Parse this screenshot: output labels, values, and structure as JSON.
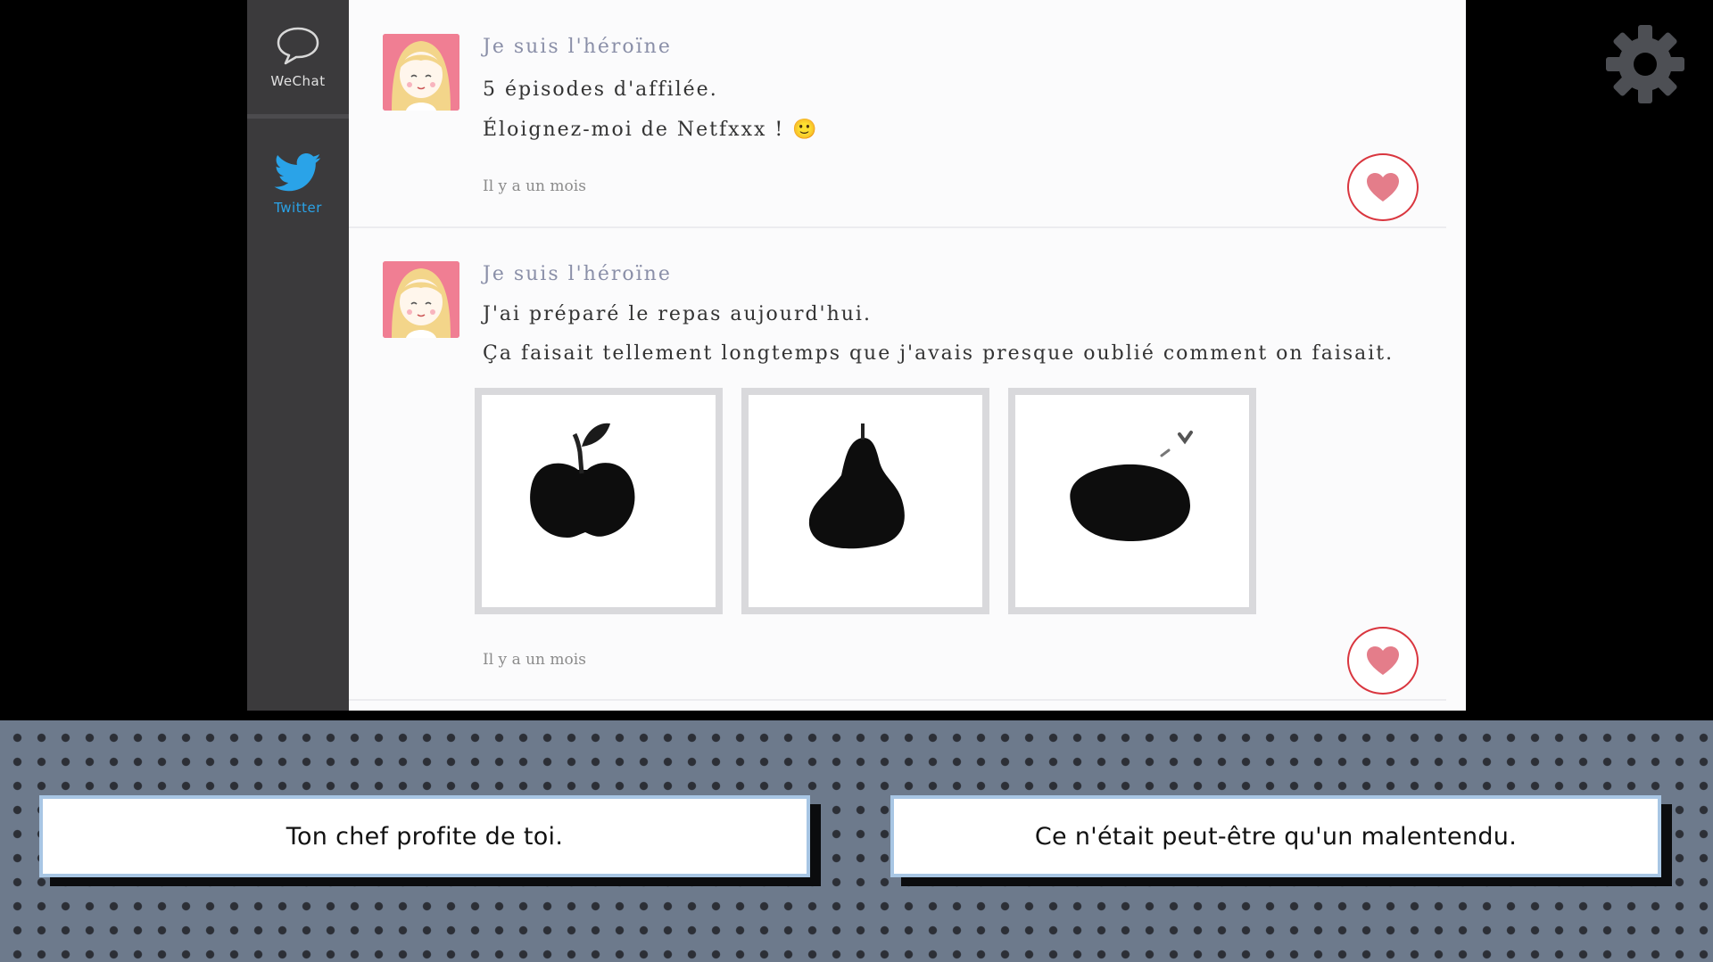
{
  "sidebar": {
    "wechat_label": "WeChat",
    "twitter_label": "Twitter"
  },
  "posts": [
    {
      "author": "Je suis l'héroïne",
      "lines": [
        "5 épisodes d'affilée.",
        "Éloignez-moi de Netfxxx ! 🙂"
      ],
      "time": "Il y a un mois"
    },
    {
      "author": "Je suis l'héroïne",
      "lines": [
        "J'ai préparé le repas aujourd'hui.",
        "Ça faisait tellement longtemps que j'avais presque oublié comment on faisait."
      ],
      "time": "Il y a un mois",
      "images": [
        "apple-image",
        "pear-image",
        "orange-image"
      ]
    }
  ],
  "choices": {
    "left": "Ton chef profite de toi.",
    "right": "Ce n'était peut-être qu'un malentendu."
  },
  "colors": {
    "accent_like": "#d9363f",
    "heart": "#e47d8a",
    "twitter_blue": "#2aa3e8",
    "author": "#8a8fa8"
  }
}
